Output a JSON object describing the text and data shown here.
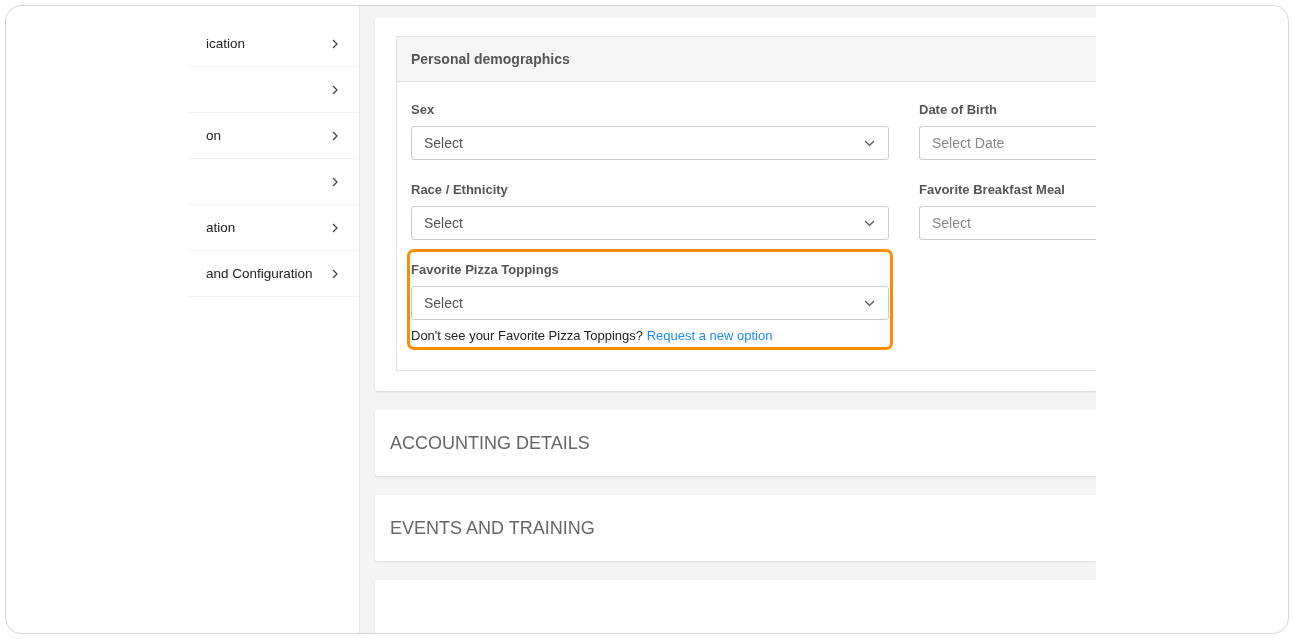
{
  "sidebar": {
    "items": [
      {
        "label": "ication",
        "expandable": true
      },
      {
        "expandable": true
      },
      {
        "label": "on",
        "expandable": true
      },
      {
        "expandable": true
      },
      {
        "label": "ation",
        "expandable": true
      },
      {
        "label": "and Configuration",
        "expandable": true
      }
    ]
  },
  "demographics": {
    "title": "Personal demographics",
    "fields": [
      {
        "label": "Sex",
        "placeholder": "Select",
        "kind": "dropdown",
        "highlighted": false
      },
      {
        "label": "Date of Birth",
        "placeholder": "Select Date",
        "kind": "input",
        "highlighted": false
      },
      {
        "label": "Race / Ethnicity",
        "placeholder": "Select",
        "kind": "dropdown",
        "highlighted": false
      },
      {
        "label": "Favorite Breakfast Meal",
        "placeholder": "Select",
        "kind": "input",
        "highlighted": false
      },
      {
        "label": "Favorite Pizza Toppings",
        "placeholder": "Select",
        "kind": "dropdown",
        "highlighted": true,
        "help": "Don't see your Favorite Pizza Toppings?",
        "link": "Request a new option"
      }
    ]
  },
  "sections": [
    {
      "title": "ACCOUNTING DETAILS"
    },
    {
      "title": "EVENTS AND TRAINING"
    }
  ]
}
